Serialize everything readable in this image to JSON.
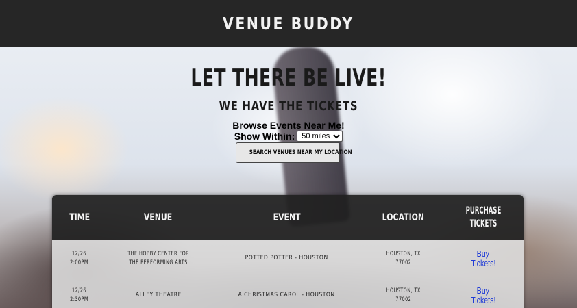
{
  "header": {
    "brand": "VENUE BUDDY"
  },
  "hero": {
    "headline": "LET THERE BE LIVE!",
    "subhead": "WE HAVE THE TICKETS",
    "browse_text": "Browse Events Near Me!",
    "within_label": "Show Within:",
    "distance_selected": "50 miles",
    "search_button": "SEARCH VENUES NEAR MY LOCATION"
  },
  "table": {
    "headers": {
      "time": "TIME",
      "venue": "VENUE",
      "event": "EVENT",
      "location": "LOCATION",
      "purchase_line1": "PURCHASE",
      "purchase_line2": "TICKETS"
    },
    "rows": [
      {
        "date": "12/26",
        "time": "2:00PM",
        "venue_line1": "THE HOBBY CENTER FOR",
        "venue_line2": "THE PERFORMING ARTS",
        "event": "POTTED POTTER - HOUSTON",
        "city": "HOUSTON, TX",
        "zip": "77002",
        "buy_line1": "Buy",
        "buy_line2": "Tickets!"
      },
      {
        "date": "12/26",
        "time": "2:30PM",
        "venue_line1": "ALLEY THEATRE",
        "venue_line2": "",
        "event": "A CHRISTMAS CAROL - HOUSTON",
        "city": "HOUSTON, TX",
        "zip": "77002",
        "buy_line1": "Buy",
        "buy_line2": "Tickets!"
      }
    ]
  }
}
